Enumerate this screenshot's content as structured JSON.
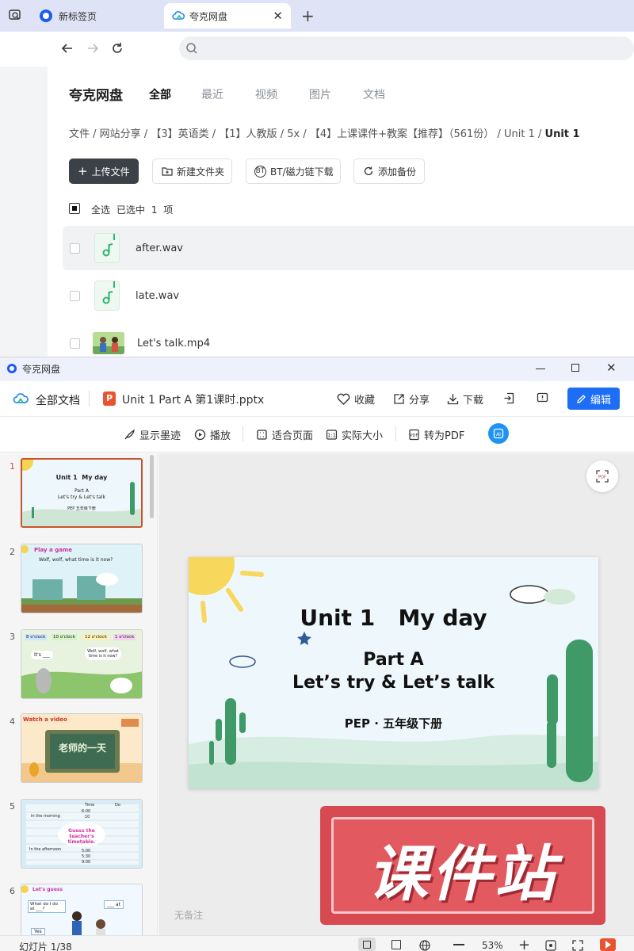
{
  "browser": {
    "tabs": [
      {
        "label": "新标签页"
      },
      {
        "label": "夸克网盘"
      }
    ]
  },
  "quark": {
    "logo": "夸克网盘",
    "nav": [
      "全部",
      "最近",
      "视频",
      "图片",
      "文档"
    ],
    "breadcrumb": [
      "文件",
      "网站分享",
      "【3】英语类",
      "【1】人教版",
      "5x",
      "【4】上课课件+教案【推荐】（561份）",
      "Unit 1",
      "Unit 1"
    ],
    "actions": {
      "upload": "上传文件",
      "new_folder": "新建文件夹",
      "bt": "BT/磁力链下载",
      "backup": "添加备份"
    },
    "select_all": "全选",
    "selected_info": "已选中 1 项",
    "files": [
      {
        "name": "after.wav",
        "type": "audio"
      },
      {
        "name": "late.wav",
        "type": "audio"
      },
      {
        "name": "Let's talk.mp4",
        "type": "video"
      }
    ]
  },
  "viewer": {
    "window_title": "夸克网盘",
    "all_docs": "全部文档",
    "file_name": "Unit 1 Part A 第1课时.pptx",
    "actions": {
      "favorite": "收藏",
      "share": "分享",
      "download": "下载",
      "edit": "编辑"
    },
    "toolbar": {
      "ink": "显示墨迹",
      "play": "播放",
      "fit_page": "适合页面",
      "actual_size": "实际大小",
      "to_pdf": "转为PDF"
    },
    "slide": {
      "title": "Unit 1   My day",
      "part": "Part A",
      "subtitle": "Let’s try & Let’s talk",
      "book": "PEP · 五年级下册"
    },
    "watermark": "课件站",
    "notes_placeholder": "无备注",
    "thumbs": [
      {
        "num": "1",
        "title": "Unit 1  My day",
        "line1": "Part A",
        "line2": "Let's try & Let's talk",
        "line3": "PEP 五年级下册"
      },
      {
        "num": "2",
        "banner": "Play a game",
        "line1": "Wolf, wolf, what time is it now?"
      },
      {
        "num": "3",
        "tags": [
          "8 o'clock",
          "10 o'clock",
          "12 o'clock",
          "1 o'clock"
        ],
        "bubble1": "It's ___",
        "bubble2": "Wolf, wolf, what time is it now?"
      },
      {
        "num": "4",
        "banner": "Watch a video",
        "screen_text": "老师的一天"
      },
      {
        "num": "5",
        "header1": "Time",
        "header2": "Do",
        "morning": "In the morning",
        "afternoon": "In the afternoon",
        "cloud": "Guess the teacher's timetable.",
        "times": [
          "6:00",
          "10",
          "",
          "5:00",
          "5:30",
          "9:00"
        ]
      },
      {
        "num": "6",
        "banner": "Let's guess",
        "line1": "What do I do at ___?",
        "line2": "Yes",
        "line3": "___ at"
      }
    ],
    "status": {
      "slide_count": "幻灯片 1/38",
      "zoom": "53%"
    }
  }
}
